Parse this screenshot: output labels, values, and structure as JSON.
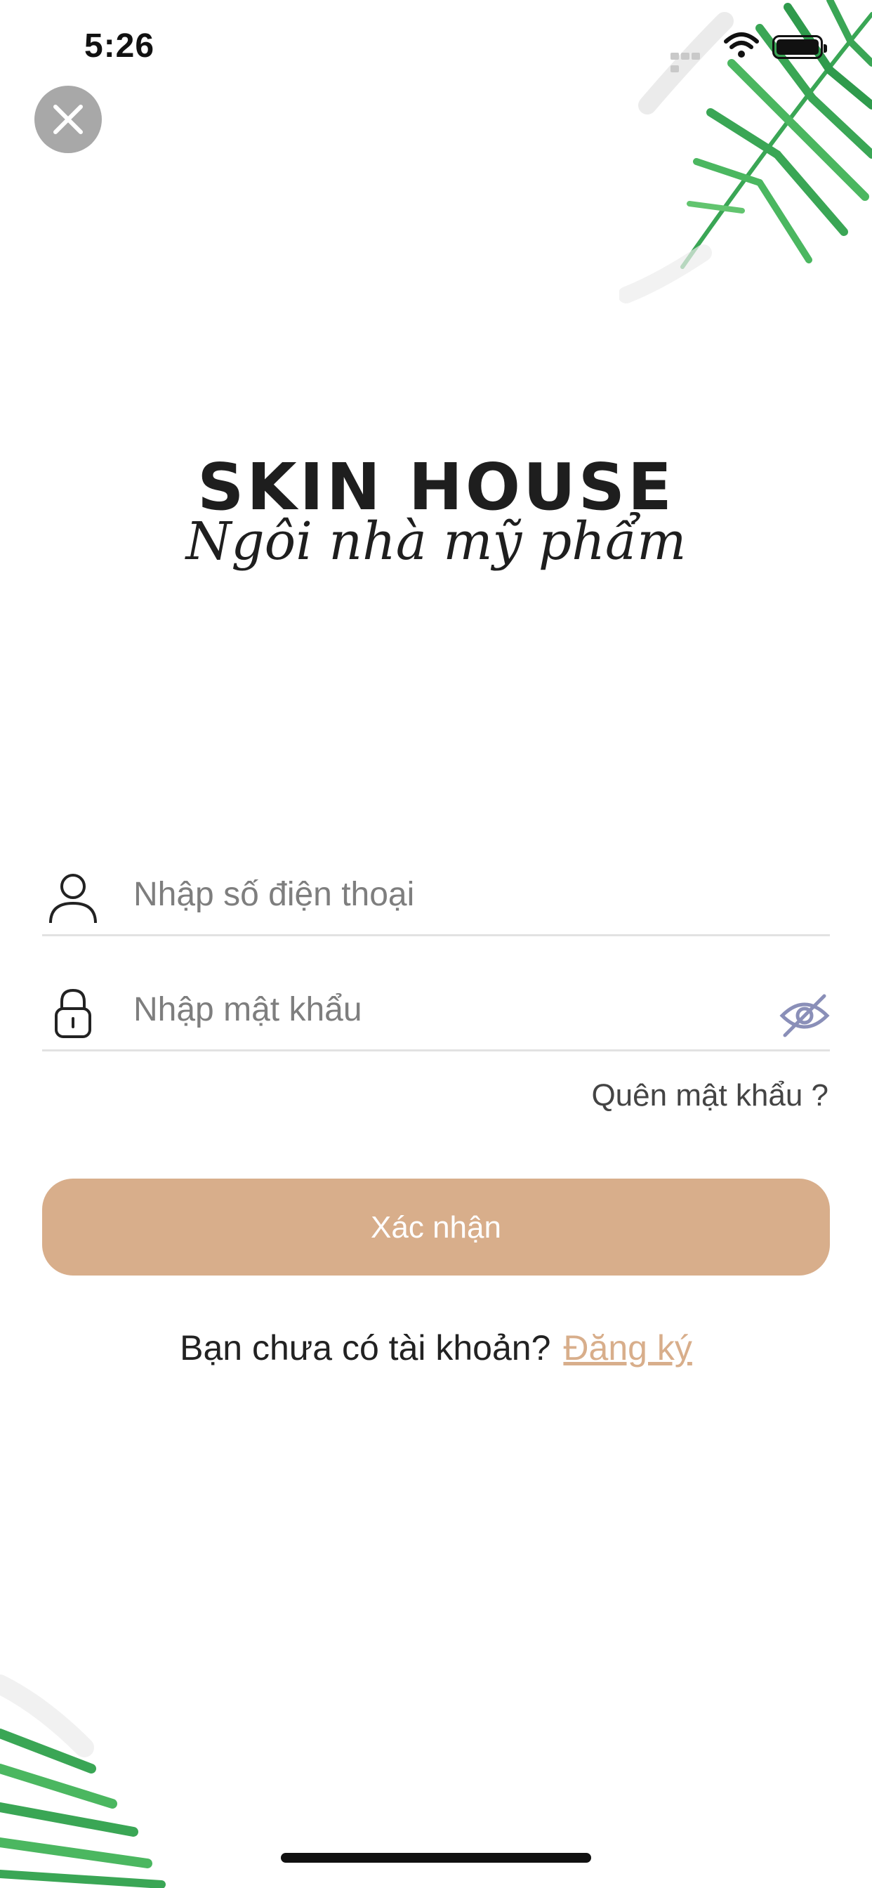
{
  "status_bar": {
    "time": "5:26"
  },
  "logo": {
    "title": "SKIN HOUSE",
    "subtitle": "Ngôi nhà mỹ phẩm"
  },
  "form": {
    "phone": {
      "placeholder": "Nhập số điện thoại",
      "value": ""
    },
    "password": {
      "placeholder": "Nhập mật khẩu",
      "value": ""
    },
    "forgot_label": "Quên mật khẩu ?",
    "submit_label": "Xác nhận"
  },
  "signup": {
    "prompt": "Bạn chưa có tài khoản?",
    "link": "Đăng ký"
  },
  "colors": {
    "accent": "#d8ae8b",
    "close_bg": "#a8a8a8",
    "eye_icon": "#8a8fb8",
    "leaf": "#3aa655"
  },
  "icons": [
    "close-icon",
    "user-icon",
    "lock-icon",
    "eye-slash-icon",
    "wifi-icon",
    "battery-icon"
  ]
}
